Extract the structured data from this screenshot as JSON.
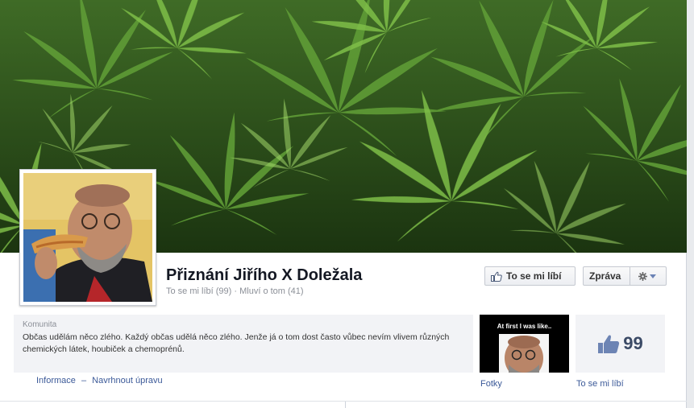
{
  "page": {
    "title": "Přiznání Jiřího X Doležala",
    "stats": {
      "likes_text": "To se mi líbí (99)",
      "separator": "·",
      "talking_text": "Mluví o tom (41)"
    }
  },
  "actions": {
    "like_label": "To se mi líbí",
    "message_label": "Zpráva"
  },
  "about": {
    "category": "Komunita",
    "description": "Občas udělám něco zlého. Každý občas udělá něco zlého. Jenže já o tom dost často vůbec nevím vlivem různých chemických látek, houbiček a chemoprénů.",
    "info_link": "Informace",
    "dash": "–",
    "suggest_link": "Navrhnout úpravu"
  },
  "tiles": {
    "photos": {
      "caption": "At first I was like..",
      "label": "Fotky"
    },
    "likes": {
      "count": "99",
      "label": "To se mi líbí"
    }
  },
  "colors": {
    "link": "#3b5998",
    "title": "#141823",
    "muted": "#8b8f97",
    "tile_bg": "#f2f3f6"
  },
  "icons": [
    "thumbs-up-icon",
    "gear-icon",
    "caret-down-icon"
  ]
}
